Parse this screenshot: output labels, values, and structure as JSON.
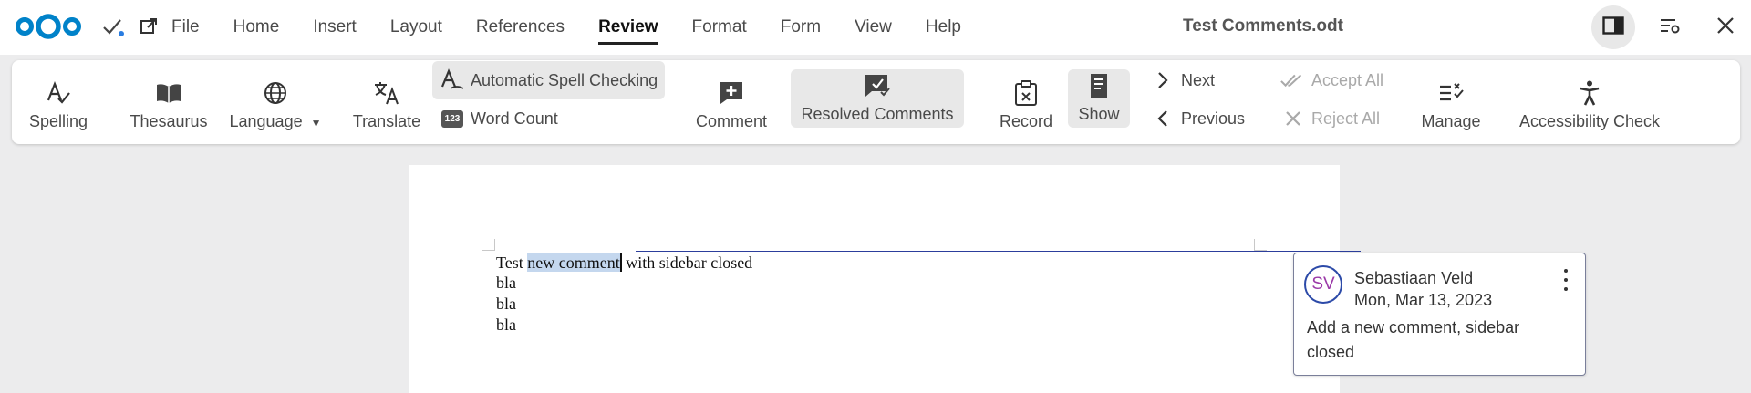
{
  "app": {
    "logo": "nextcloud-logo",
    "save_status_icon": "check-icon",
    "open_external_icon": "external-link-icon"
  },
  "menu": {
    "items": [
      "File",
      "Home",
      "Insert",
      "Layout",
      "References",
      "Review",
      "Format",
      "Form",
      "View",
      "Help"
    ],
    "active": "Review"
  },
  "document": {
    "title": "Test Comments.odt"
  },
  "window_controls": {
    "sidebar_icon": "sidebar-toggle-icon",
    "settings_icon": "settings-icon",
    "close_icon": "close-icon"
  },
  "ribbon": {
    "spelling": "Spelling",
    "thesaurus": "Thesaurus",
    "language": "Language",
    "translate": "Translate",
    "auto_spell": "Automatic Spell Checking",
    "word_count": "Word Count",
    "word_count_badge": "123",
    "comment": "Comment",
    "resolved_comments": "Resolved Comments",
    "record": "Record",
    "show": "Show",
    "next": "Next",
    "previous": "Previous",
    "accept_all": "Accept All",
    "reject_all": "Reject All",
    "manage": "Manage",
    "accessibility_check": "Accessibility Check"
  },
  "content": {
    "line1_before": "Test ",
    "line1_selected": "new comment",
    "line1_after": " with sidebar closed",
    "line2": "bla",
    "line3": "bla",
    "line4": "bla"
  },
  "comment": {
    "initials": "SV",
    "author": "Sebastiaan Veld",
    "date": "Mon, Mar 13, 2023",
    "text": "Add a new comment, sidebar closed"
  },
  "colors": {
    "selection": "#c4d7ee",
    "anchor_line": "#2c3e9c",
    "avatar_border": "#2c4aa8",
    "avatar_text": "#9b3aa8",
    "logo_blue": "#0082c9"
  }
}
